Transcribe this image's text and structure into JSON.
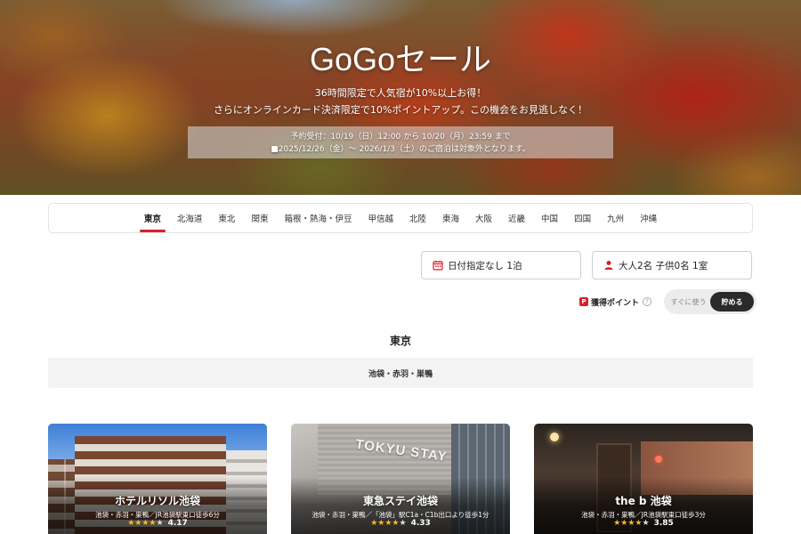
{
  "hero": {
    "title": "GoGoセール",
    "line1": "36時間限定で人気宿が10%以上お得！",
    "line2": "さらにオンラインカード決済限定で10%ポイントアップ。この機会をお見逃しなく！",
    "notice1": "予約受付：10/19（日）12:00 から 10/20（月）23:59 まで",
    "notice2": "■2025/12/26（金）～ 2026/1/3（土）のご宿泊は対象外となります。"
  },
  "regions": [
    {
      "label": "東京",
      "active": true
    },
    {
      "label": "北海道"
    },
    {
      "label": "東北"
    },
    {
      "label": "関東"
    },
    {
      "label": "箱根・熱海・伊豆"
    },
    {
      "label": "甲信越"
    },
    {
      "label": "北陸"
    },
    {
      "label": "東海"
    },
    {
      "label": "大阪"
    },
    {
      "label": "近畿"
    },
    {
      "label": "中国"
    },
    {
      "label": "四国"
    },
    {
      "label": "九州"
    },
    {
      "label": "沖縄"
    }
  ],
  "search": {
    "date_label": "日付指定なし 1泊",
    "guests_label": "大人2名  子供0名  1室"
  },
  "points": {
    "icon_text": "P",
    "label": "獲得ポイント",
    "help": "?",
    "option_use": "すぐに使う",
    "option_save": "貯める",
    "selected": "貯める"
  },
  "section": {
    "title": "東京",
    "area": "池袋・赤羽・巣鴨"
  },
  "hotels": [
    {
      "name": "ホテルリソル池袋",
      "access": "池袋・赤羽・巣鴨／JR池袋駅東口徒歩6分",
      "stars": "★★★★",
      "stars_dim": "★",
      "rating": "4.17"
    },
    {
      "name": "東急ステイ池袋",
      "access": "池袋・赤羽・巣鴨／「池袋」駅C1a・C1b出口より徒歩1分",
      "stars": "★★★★",
      "stars_dim": "★",
      "rating": "4.33",
      "logo": "TOKYU STAY"
    },
    {
      "name": "the b 池袋",
      "access": "池袋・赤羽・巣鴨／JR池袋駅東口徒歩3分",
      "stars": "★★★★",
      "stars_dim": "★",
      "rating": "3.85"
    }
  ],
  "colors": {
    "accent": "#d8202b",
    "star": "#f5b82e"
  }
}
